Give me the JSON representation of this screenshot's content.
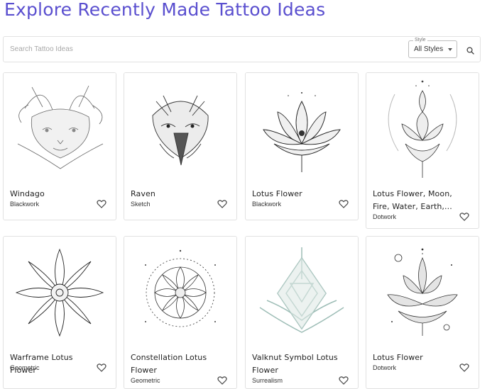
{
  "page": {
    "title": "Explore Recently Made Tattoo Ideas"
  },
  "search": {
    "placeholder": "Search Tattoo Ideas",
    "style_label": "Style",
    "style_value": "All Styles",
    "search_icon": "search-icon"
  },
  "cards": [
    {
      "title": "Windago",
      "style": "Blackwork",
      "icon": "heart-outline-icon"
    },
    {
      "title": "Raven",
      "style": "Sketch",
      "icon": "heart-outline-icon"
    },
    {
      "title": "Lotus Flower",
      "style": "Blackwork",
      "icon": "heart-outline-icon"
    },
    {
      "title": "Lotus Flower, Moon, Fire, Water, Earth,...",
      "style": "Dotwork",
      "icon": "heart-outline-icon"
    },
    {
      "title": "Warframe Lotus Flower",
      "style": "Geometric",
      "icon": "heart-outline-icon"
    },
    {
      "title": "Constellation Lotus Flower",
      "style": "Geometric",
      "icon": "heart-outline-icon"
    },
    {
      "title": "Valknut Symbol Lotus Flower",
      "style": "Surrealism",
      "icon": "heart-outline-icon"
    },
    {
      "title": "Lotus Flower",
      "style": "Dotwork",
      "icon": "heart-outline-icon"
    }
  ]
}
